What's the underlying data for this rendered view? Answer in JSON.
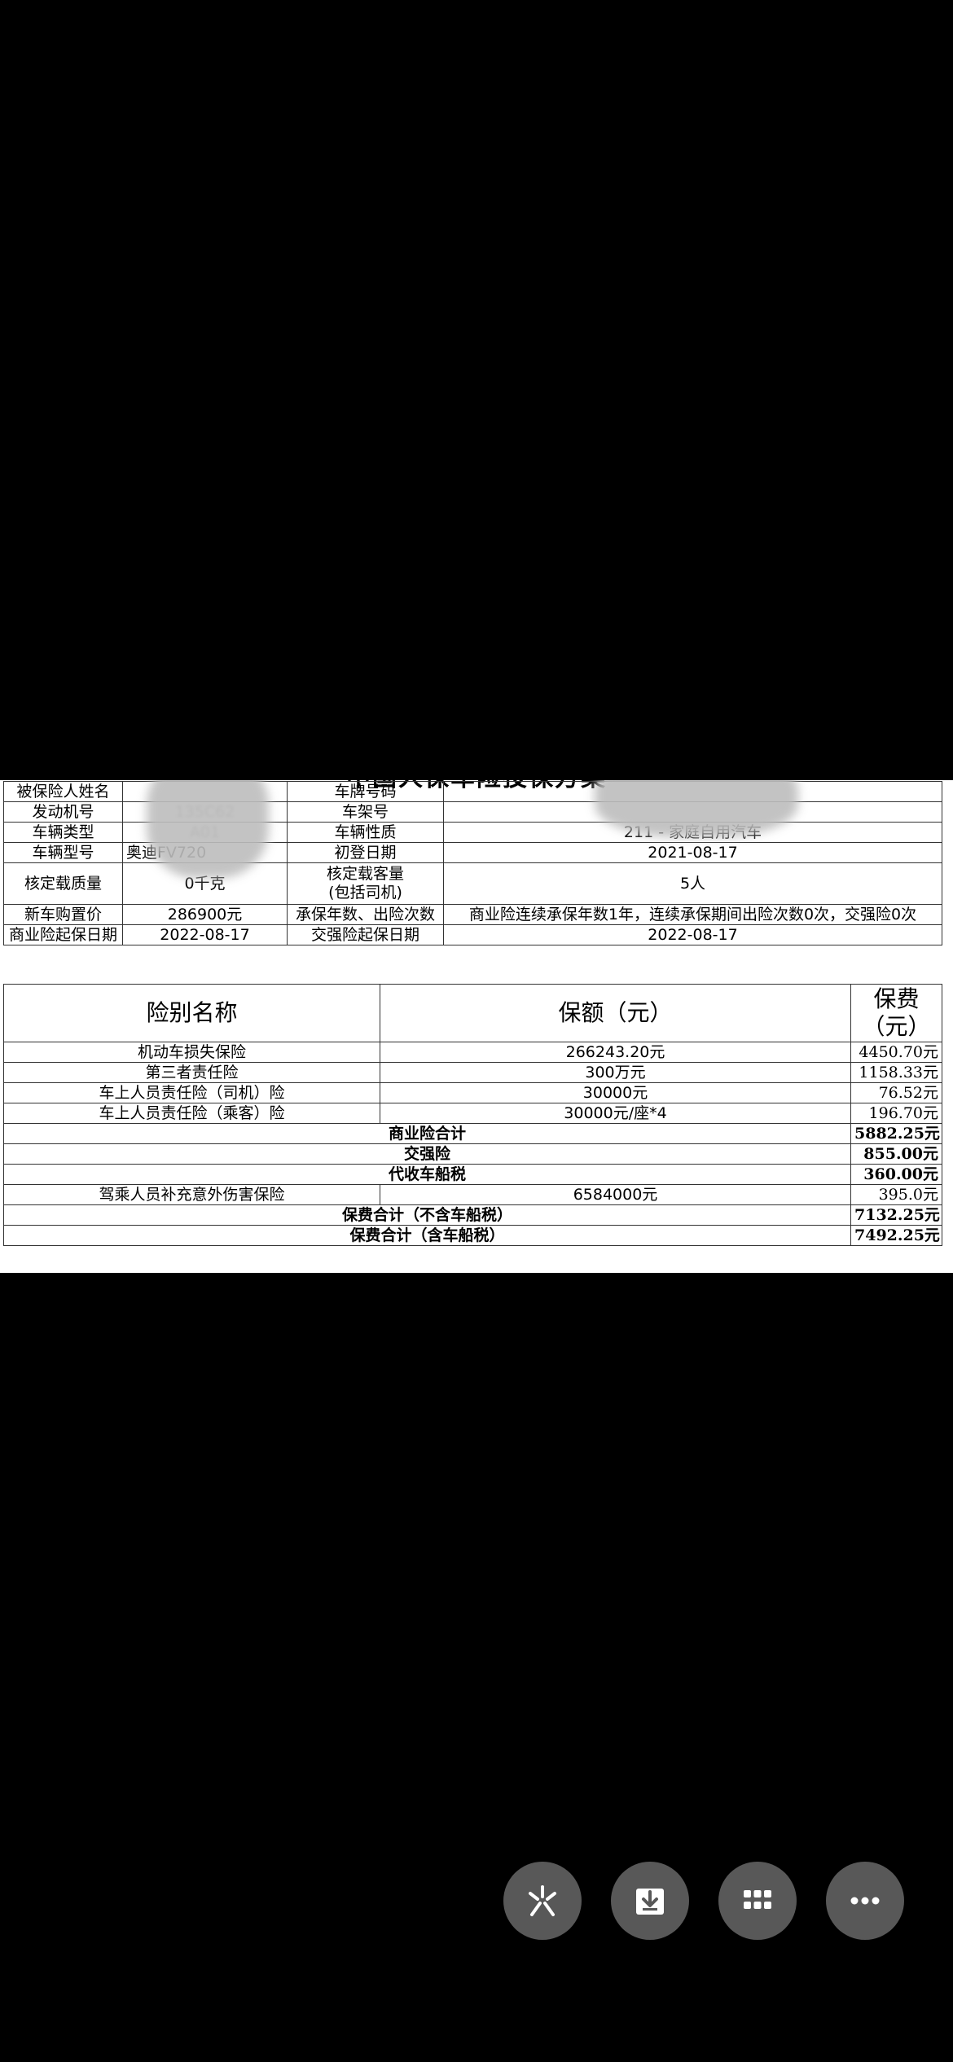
{
  "document": {
    "title": "中国人保车险投保方案",
    "info_rows": [
      {
        "l1": "被保险人姓名",
        "v1": "",
        "l2": "车牌号码",
        "v2": ""
      },
      {
        "l1": "发动机号",
        "v1": "135C62",
        "l2": "车架号",
        "v2": ""
      },
      {
        "l1": "车辆类型",
        "v1": "A01",
        "l2": "车辆性质",
        "v2": "211 - 家庭自用汽车"
      },
      {
        "l1": "车辆型号",
        "v1": "奥迪FV720",
        "l2": "初登日期",
        "v2": "2021-08-17"
      },
      {
        "l1": "核定载质量",
        "v1": "0千克",
        "l2": "核定载客量\n(包括司机)",
        "v2": "5人"
      },
      {
        "l1": "新车购置价",
        "v1": "286900元",
        "l2": "承保年数、出险次数",
        "v2": "商业险连续承保年数1年，连续承保期间出险次数0次，交强险0次"
      },
      {
        "l1": "商业险起保日期",
        "v1": "2022-08-17",
        "l2": "交强险起保日期",
        "v2": "2022-08-17"
      }
    ],
    "insurance_headers": {
      "name": "险别名称",
      "amount": "保额（元）",
      "fee": "保费\n（元）"
    },
    "coverage_rows": [
      {
        "name": "机动车损失保险",
        "amount": "266243.20元",
        "fee": "4450.70元"
      },
      {
        "name": "第三者责任险",
        "amount": "300万元",
        "fee": "1158.33元"
      },
      {
        "name": "车上人员责任险（司机）险",
        "amount": "30000元",
        "fee": "76.52元"
      },
      {
        "name": "车上人员责任险（乘客）险",
        "amount": "30000元/座*4",
        "fee": "196.70元"
      }
    ],
    "totals": {
      "commercial_label": "商业险合计",
      "commercial_fee": "5882.25元",
      "compulsory_label": "交强险",
      "compulsory_fee": "855.00元",
      "tax_label": "代收车船税",
      "tax_fee": "360.00元",
      "extra_name": "驾乘人员补充意外伤害保险",
      "extra_amount": "6584000元",
      "extra_fee": "395.0元",
      "excl_label": "保费合计（不含车船税）",
      "excl_fee": "7132.25元",
      "incl_label": "保费合计（含车船税）",
      "incl_fee": "7492.25元"
    }
  },
  "actions": [
    {
      "icon": "sparkle-icon"
    },
    {
      "icon": "download-icon"
    },
    {
      "icon": "grid-icon"
    },
    {
      "icon": "more-icon"
    }
  ]
}
